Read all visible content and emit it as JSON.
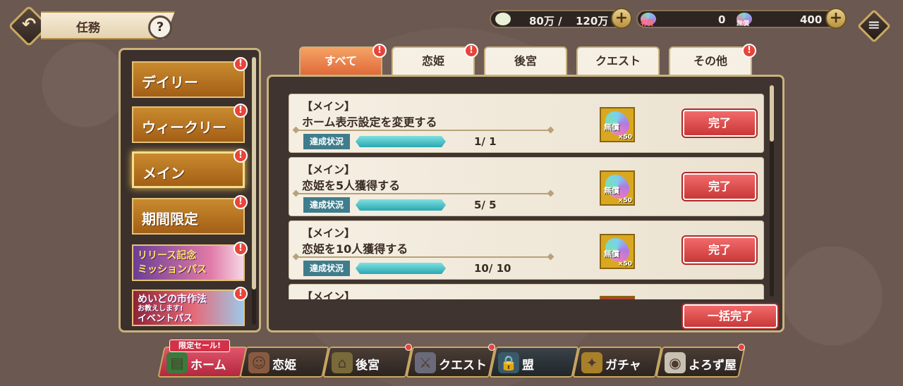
{
  "header": {
    "title": "任務",
    "help_label": "?",
    "back_label": "↶",
    "menu_label": "≡"
  },
  "resources": {
    "stamina_current": "80万 /",
    "stamina_max": "120万",
    "paid_gem_label": "有償",
    "paid_gem_count": "0",
    "free_gem_label": "無償",
    "free_gem_count": "400",
    "plus_label": "+"
  },
  "sidebar": {
    "items": [
      {
        "label": "デイリー",
        "badge": "!"
      },
      {
        "label": "ウィークリー",
        "badge": "!"
      },
      {
        "label": "メイン",
        "badge": "!"
      },
      {
        "label": "期間限定",
        "badge": "!"
      }
    ],
    "banners": [
      {
        "line1": "リリース記念",
        "line2": "ミッションパス",
        "badge": "!"
      },
      {
        "line1": "めいどの",
        "line2": "市作法",
        "line3": "お教えします!",
        "line4": "イベントパス",
        "badge": "!"
      }
    ]
  },
  "tabs": [
    {
      "label": "すべて",
      "badge": "!"
    },
    {
      "label": "恋姫",
      "badge": "!"
    },
    {
      "label": "後宮",
      "badge": ""
    },
    {
      "label": "クエスト",
      "badge": ""
    },
    {
      "label": "その他",
      "badge": "!"
    }
  ],
  "missions": [
    {
      "category": "【メイン】",
      "description": "ホーム表示設定を変更する",
      "status_label": "達成状況",
      "progress": "1/ 1",
      "progress_fraction": 1.0,
      "reward_label": "無償",
      "reward_qty": "×50",
      "button": "完了"
    },
    {
      "category": "【メイン】",
      "description": "恋姫を5人獲得する",
      "status_label": "達成状況",
      "progress": "5/ 5",
      "progress_fraction": 1.0,
      "reward_label": "無償",
      "reward_qty": "×50",
      "button": "完了"
    },
    {
      "category": "【メイン】",
      "description": "恋姫を10人獲得する",
      "status_label": "達成状況",
      "progress": "10/ 10",
      "progress_fraction": 1.0,
      "reward_label": "無償",
      "reward_qty": "×50",
      "button": "完了"
    },
    {
      "category": "【メイン】"
    }
  ],
  "all_complete_label": "一括完了",
  "bottom_nav": {
    "sale_tag": "限定セール!",
    "items": [
      {
        "label": "ホーム",
        "icon": "books-icon"
      },
      {
        "label": "恋姫",
        "icon": "girl-portrait-icon"
      },
      {
        "label": "後宮",
        "icon": "palace-icon"
      },
      {
        "label": "クエスト",
        "icon": "crossed-swords-icon"
      },
      {
        "label": "盟",
        "icon": "flag-lock-icon"
      },
      {
        "label": "ガチャ",
        "icon": "sparkle-treasure-icon"
      },
      {
        "label": "よろず屋",
        "icon": "shop-bag-icon"
      }
    ]
  },
  "colors": {
    "accent_red": "#e8443a",
    "tab_active": "#e06a3a",
    "panel_border": "#c9b27e"
  }
}
